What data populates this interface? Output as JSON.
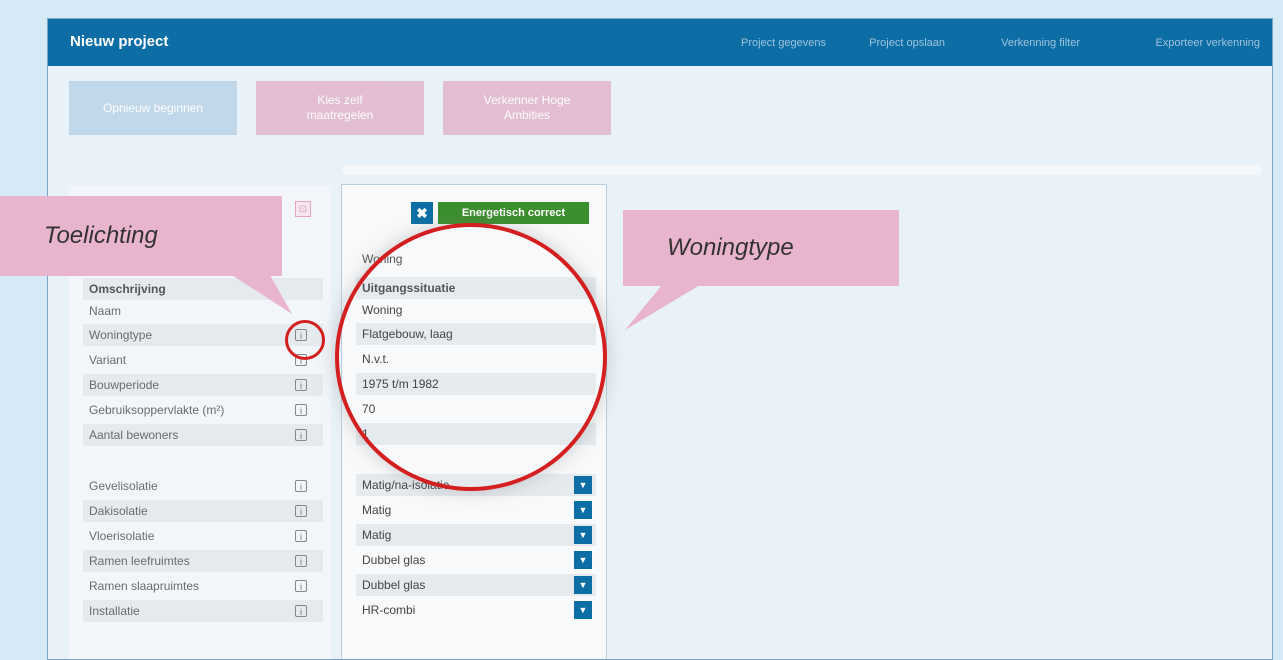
{
  "app_title": "Nieuw project",
  "nav": [
    "Project gegevens",
    "Project opslaan",
    "Verkenning filter",
    "Exporteer verkenning"
  ],
  "buttons": {
    "restart": "Opnieuw beginnen",
    "choose": "Kies zelf maatregelen",
    "explorer": "Verkenner Hoge Ambities",
    "close_glyph": "✖",
    "correct": "Energetisch correct"
  },
  "left_rows": [
    {
      "label": "Omschrijving",
      "bold": true,
      "info": false
    },
    {
      "label": "Naam",
      "info": false
    },
    {
      "label": "Woningtype",
      "info": true
    },
    {
      "label": "Variant",
      "info": true
    },
    {
      "label": "Bouwperiode",
      "info": true
    },
    {
      "label": "Gebruiksoppervlakte (m²)",
      "info": true
    },
    {
      "label": "Aantal bewoners",
      "info": true
    },
    {
      "label": "Gevelisolatie",
      "info": true
    },
    {
      "label": "Dakisolatie",
      "info": true
    },
    {
      "label": "Vloerisolatie",
      "info": true
    },
    {
      "label": "Ramen leefruimtes",
      "info": true
    },
    {
      "label": "Ramen slaapruimtes",
      "info": true
    },
    {
      "label": "Installatie",
      "info": true
    }
  ],
  "mid_header": "Woning",
  "mid_rows": [
    {
      "value": "Uitgangssituatie",
      "bold": true
    },
    {
      "value": "Woning"
    },
    {
      "value": "Flatgebouw, laag"
    },
    {
      "value": "N.v.t."
    },
    {
      "value": "1975 t/m 1982"
    },
    {
      "value": "70"
    },
    {
      "value": "1"
    }
  ],
  "mid_selects": [
    "Matig/na-isolatie",
    "Matig",
    "Matig",
    "Dubbel glas",
    "Dubbel glas",
    "HR-combi"
  ],
  "info_glyph": "i",
  "callouts": {
    "left": "Toelichting",
    "right": "Woningtype"
  },
  "colors": {
    "header": "#0d6ea5",
    "accent_green": "#3b8f2d",
    "callout_pink": "#e9b4cd",
    "highlight_red": "#d31f1f"
  }
}
